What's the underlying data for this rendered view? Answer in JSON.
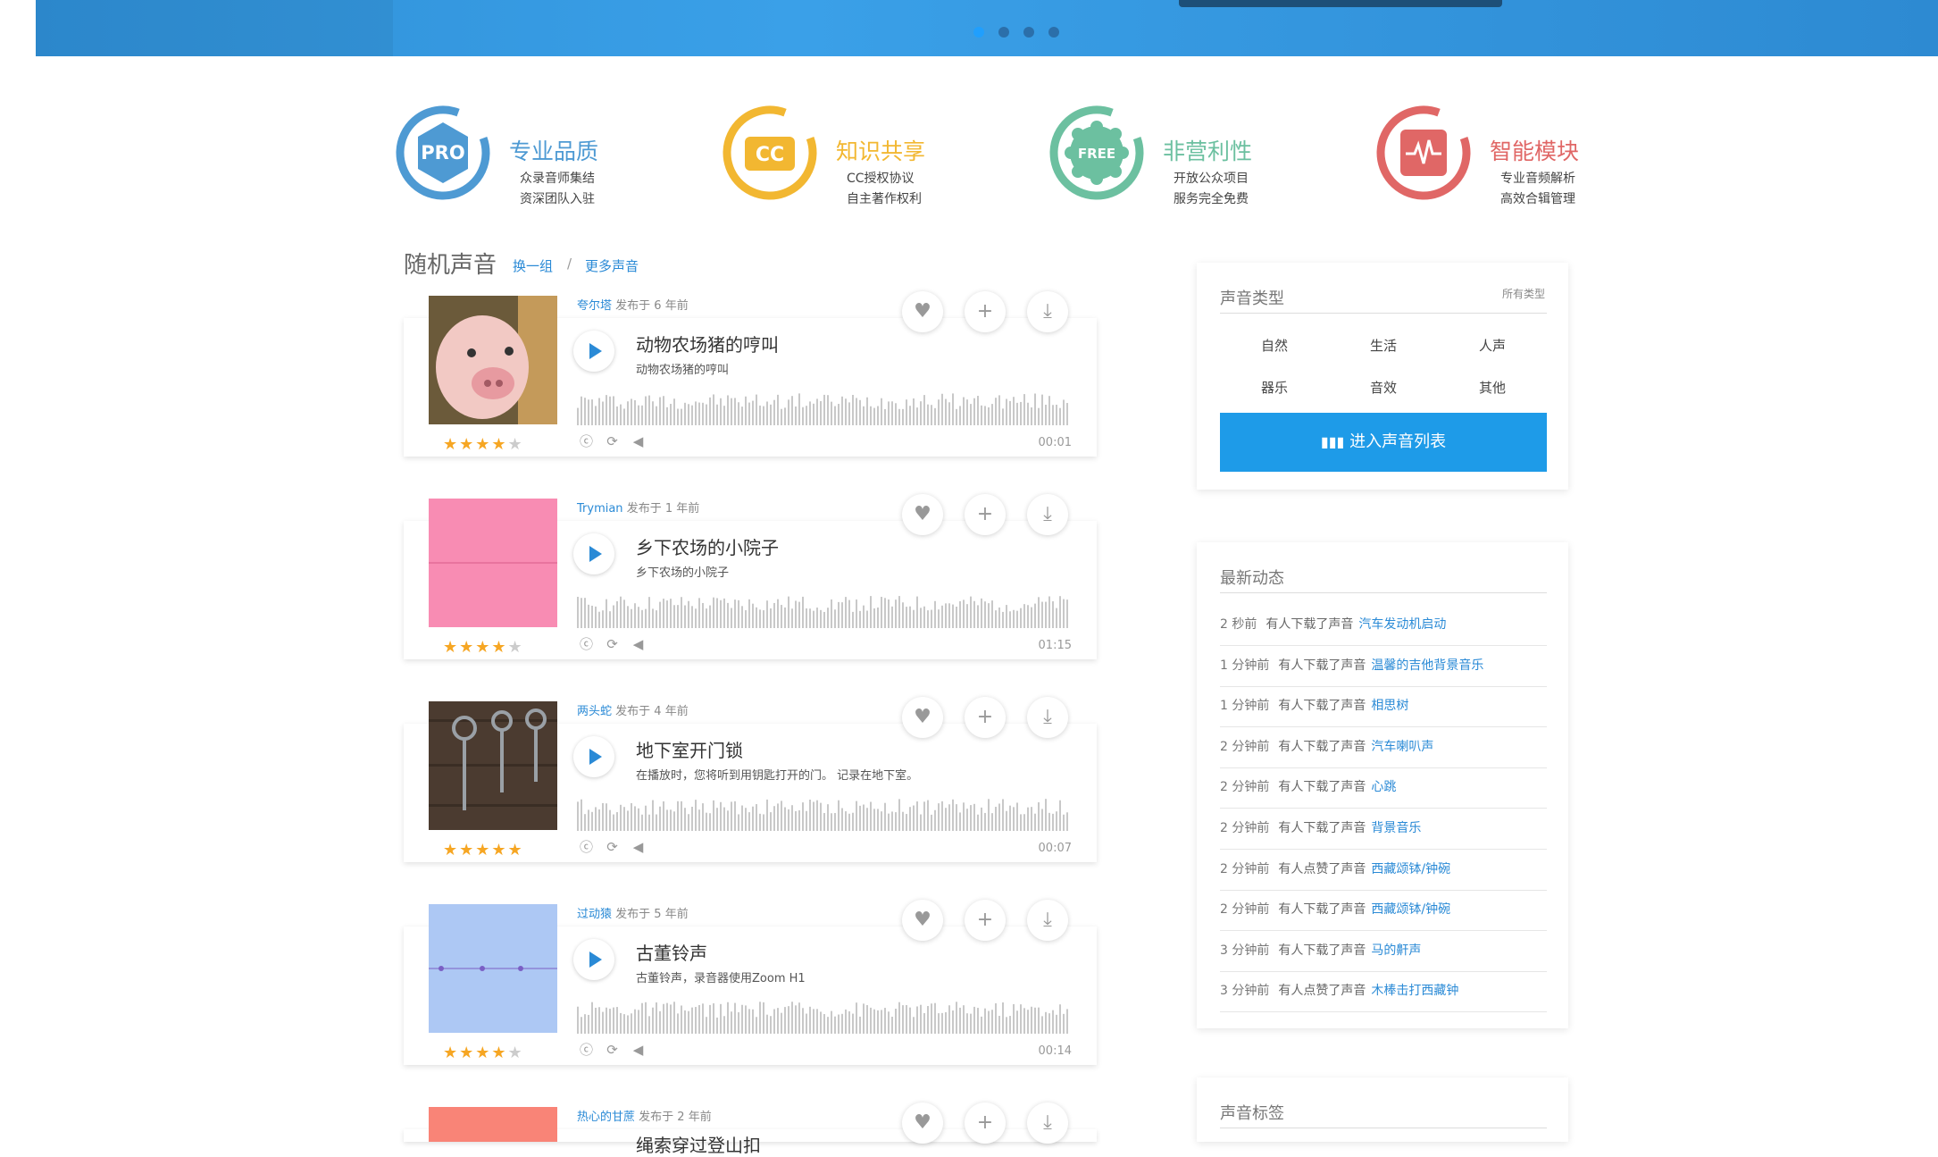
{
  "features": [
    {
      "badge": "PRO",
      "title": "专业品质",
      "lines": [
        "众录音师集结",
        "资深团队入驻"
      ],
      "color": "#4e9ad3"
    },
    {
      "badge": "CC",
      "title": "知识共享",
      "lines": [
        "CC授权协议",
        "自主著作权利"
      ],
      "color": "#f2b731"
    },
    {
      "badge": "FREE",
      "title": "非营利性",
      "lines": [
        "开放公众项目",
        "服务完全免费"
      ],
      "color": "#6cc0a0"
    },
    {
      "badge": "pulse-icon",
      "title": "智能模块",
      "lines": [
        "专业音频解析",
        "高效合辑管理"
      ],
      "color": "#e06766"
    }
  ],
  "section": {
    "title": "随机声音",
    "refresh": "换一组",
    "sep": "/",
    "more": "更多声音"
  },
  "sounds": [
    {
      "author": "夸尔塔",
      "published": "发布于 6 年前",
      "title": "动物农场猪的哼叫",
      "desc": "动物农场猪的哼叫",
      "duration": "00:01",
      "rating": 4,
      "thumb": "pig-photo"
    },
    {
      "author": "Trymian",
      "published": "发布于 1 年前",
      "title": "乡下农场的小院子",
      "desc": "乡下农场的小院子",
      "duration": "01:15",
      "rating": 4,
      "thumb": "pink-waveform"
    },
    {
      "author": "两头蛇",
      "published": "发布于 4 年前",
      "title": "地下室开门锁",
      "desc": "在播放时，您将听到用钥匙打开的门。 记录在地下室。",
      "duration": "00:07",
      "rating": 5,
      "thumb": "keys-photo"
    },
    {
      "author": "过动猿",
      "published": "发布于 5 年前",
      "title": "古董铃声",
      "desc": "古董铃声，录音器使用Zoom H1",
      "duration": "00:14",
      "rating": 4.5,
      "thumb": "blue-waveform"
    },
    {
      "author": "热心的甘蔗",
      "published": "发布于 2 年前",
      "title": "绳索穿过登山扣",
      "desc": "",
      "duration": "",
      "rating": 0,
      "thumb": "salmon-waveform"
    }
  ],
  "types_panel": {
    "title": "声音类型",
    "all": "所有类型",
    "types": [
      "自然",
      "生活",
      "人声",
      "器乐",
      "音效",
      "其他"
    ],
    "enter_button": "进入声音列表"
  },
  "activity_panel": {
    "title": "最新动态",
    "items": [
      {
        "time": "2 秒前",
        "action": "有人下载了声音",
        "sound": "汽车发动机启动"
      },
      {
        "time": "1 分钟前",
        "action": "有人下载了声音",
        "sound": "温馨的吉他背景音乐"
      },
      {
        "time": "1 分钟前",
        "action": "有人下载了声音",
        "sound": "相思树"
      },
      {
        "time": "2 分钟前",
        "action": "有人下载了声音",
        "sound": "汽车喇叭声"
      },
      {
        "time": "2 分钟前",
        "action": "有人下载了声音",
        "sound": "心跳"
      },
      {
        "time": "2 分钟前",
        "action": "有人下载了声音",
        "sound": "背景音乐"
      },
      {
        "time": "2 分钟前",
        "action": "有人点赞了声音",
        "sound": "西藏颂钵/钟碗"
      },
      {
        "time": "2 分钟前",
        "action": "有人下载了声音",
        "sound": "西藏颂钵/钟碗"
      },
      {
        "time": "3 分钟前",
        "action": "有人下载了声音",
        "sound": "马的鼾声"
      },
      {
        "time": "3 分钟前",
        "action": "有人点赞了声音",
        "sound": "木棒击打西藏钟"
      }
    ]
  },
  "tags_panel": {
    "title": "声音标签"
  }
}
